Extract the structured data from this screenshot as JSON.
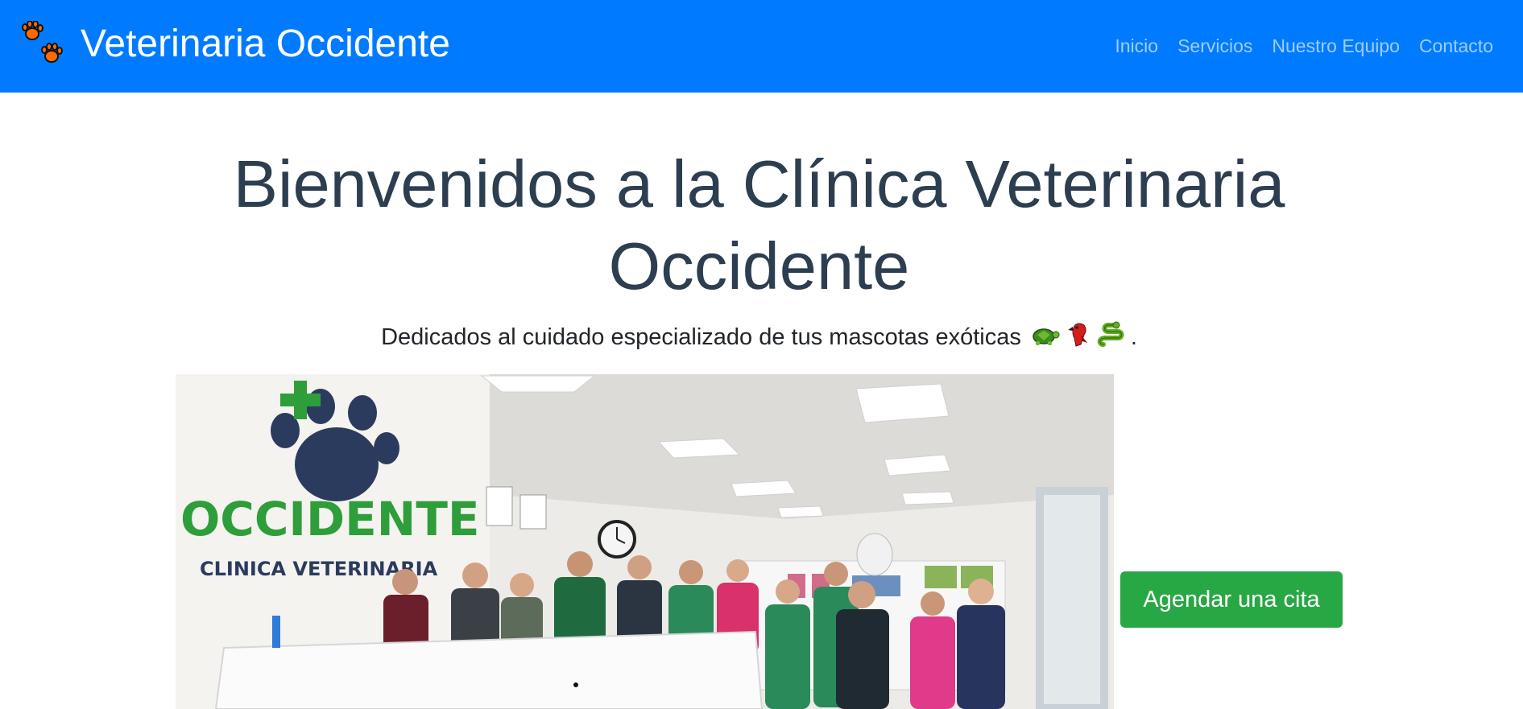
{
  "header": {
    "brand_title": "Veterinaria Occidente",
    "brand_icon": "paw-prints-icon",
    "background_color": "#007bff",
    "nav_items": [
      {
        "label": "Inicio"
      },
      {
        "label": "Servicios"
      },
      {
        "label": "Nuestro Equipo"
      },
      {
        "label": "Contacto"
      }
    ]
  },
  "hero": {
    "title": "Bienvenidos a la Clínica Veterinaria Occidente",
    "subtitle": "Dedicados al cuidado especializado de tus mascotas exóticas",
    "subtitle_end": ".",
    "emojis": [
      "turtle-icon",
      "parrot-icon",
      "snake-icon"
    ],
    "title_color": "#2c3e50"
  },
  "photo": {
    "sign_main": "OCCIDENTE",
    "sign_sub": "CLINICA VETERINARIA",
    "slide_indicator": "carousel-dot"
  },
  "cta": {
    "label": "Agendar una cita",
    "color": "#28a745"
  }
}
